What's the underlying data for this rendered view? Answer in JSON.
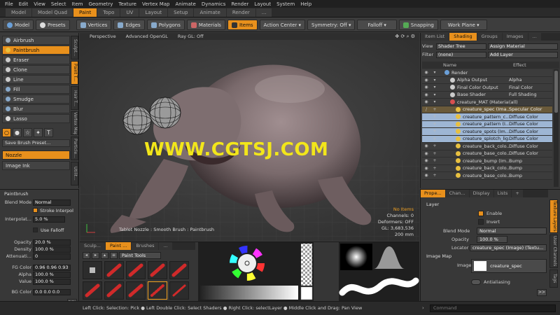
{
  "menu": [
    "File",
    "Edit",
    "View",
    "Select",
    "Item",
    "Geometry",
    "Texture",
    "Vertex Map",
    "Animate",
    "Dynamics",
    "Render",
    "Layout",
    "System",
    "Help"
  ],
  "layout_tabs": [
    "Model",
    "Model Quad",
    "Paint",
    "Topo",
    "UV",
    "Layout",
    "Setup",
    "Animate",
    "Render",
    "..."
  ],
  "active_layout_tab": "Paint",
  "toolbar": {
    "model": "Model",
    "presets": "Presets",
    "vertices": "Vertices",
    "edges": "Edges",
    "polygons": "Polygons",
    "materials": "Materials",
    "items": "Items",
    "action_center": "Action Center",
    "symmetry": "Symmetry: Off",
    "falloff": "Falloff",
    "snapping": "Snapping",
    "work_plane": "Work Plane"
  },
  "tools": [
    "Airbrush",
    "Paintbrush",
    "Eraser",
    "Clone",
    "Line",
    "Fill",
    "Smudge",
    "Blur",
    "Lasso"
  ],
  "active_tool": "Paintbrush",
  "left_vtabs": [
    "Sculpt...",
    "Paint T...",
    "Hair T...",
    "Vertex Map...",
    "Particle...",
    "Utilit..."
  ],
  "brush_icons": [
    "○",
    "●",
    "☆",
    "✦",
    "T"
  ],
  "save_brush_preset": "Save Brush Preset...",
  "nozzle": "Nozzle",
  "image_ink": "Image Ink",
  "paintbrush_props": {
    "title": "Paintbrush",
    "blend_mode_label": "Blend Mode",
    "blend_mode": "Normal",
    "stroke_interp": "Stroke Interpol ...",
    "interpolation_label": "Interpolat...",
    "interpolation": "5.0 %",
    "use_falloff": "Use Falloff",
    "opacity_label": "Opacity",
    "opacity": "20.0 %",
    "density_label": "Density",
    "density": "100.0 %",
    "attenuation_label": "Attenuati...",
    "attenuation": "0",
    "fg_color_label": "FG Color",
    "fg_color": "0.96  0.96  0.93",
    "alpha_label": "Alpha",
    "alpha": "100.0 %",
    "value_label": "Value",
    "value": "100.0 %",
    "bg_color_label": "BG Color",
    "bg_color": "0.0    0.0    0.0"
  },
  "viewport": {
    "perspective": "Perspective",
    "opengl": "Advanced OpenGL",
    "raygl": "Ray GL: Off",
    "no_items": "No Items",
    "channels": "Channels: 0",
    "deformers": "Deformers: OFF",
    "gl": "GL: 3,683,536",
    "size": "200 mm",
    "status": "Tablet Nozzle : Smooth Brush : Paintbrush",
    "watermark": "WWW.CGTSJ.COM"
  },
  "right_tabs": [
    "Item List",
    "Shading",
    "Groups",
    "Images",
    "..."
  ],
  "active_right_tab": "Shading",
  "shader_controls": {
    "view_label": "View",
    "view_value": "Shader Tree",
    "assign_material": "Assign Material",
    "filter_label": "Filter",
    "filter_value": "(none)",
    "add_layer": "Add Layer"
  },
  "shader_tree_header": {
    "name": "Name",
    "effect": "Effect"
  },
  "shader_tree": [
    {
      "name": "Render",
      "effect": "",
      "eye": "◉",
      "dot": "#6a9fd8",
      "indent": 8,
      "state": ""
    },
    {
      "name": "Alpha Output",
      "effect": "Alpha",
      "eye": "◉",
      "dot": "#cccccc",
      "indent": 16,
      "state": ""
    },
    {
      "name": "Final Color Output",
      "effect": "Final Color",
      "eye": "◉",
      "dot": "#cccccc",
      "indent": 16,
      "state": ""
    },
    {
      "name": "Base Shader",
      "effect": "Full Shading",
      "eye": "◉",
      "dot": "#cccccc",
      "indent": 16,
      "state": ""
    },
    {
      "name": "creature_MAT (Material)",
      "effect": "(all)",
      "eye": "◉",
      "dot": "#d85050",
      "indent": 16,
      "state": ""
    },
    {
      "name": "creature_spec (Ima...",
      "effect": "Specular Color",
      "eye": "/",
      "dot": "#e8c040",
      "indent": 24,
      "state": "sel"
    },
    {
      "name": "creature_pattern_c...",
      "effect": "Diffuse Color",
      "eye": "",
      "dot": "#e8c040",
      "indent": 24,
      "state": ""
    },
    {
      "name": "creature_pattern (I...",
      "effect": "Diffuse Color",
      "eye": "",
      "dot": "#e8c040",
      "indent": 24,
      "state": ""
    },
    {
      "name": "creature_spots (Im...",
      "effect": "Diffuse Color",
      "eye": "",
      "dot": "#e8c040",
      "indent": 24,
      "state": ""
    },
    {
      "name": "creature_splotch_lig...",
      "effect": "Diffuse Color",
      "eye": "",
      "dot": "#e8c040",
      "indent": 24,
      "state": ""
    },
    {
      "name": "creature_back_colo...",
      "effect": "Diffuse Color",
      "eye": "◉",
      "dot": "#e8c040",
      "indent": 24,
      "state": ""
    },
    {
      "name": "creature_base_colo...",
      "effect": "Diffuse Color",
      "eye": "◉",
      "dot": "#e8c040",
      "indent": 24,
      "state": ""
    },
    {
      "name": "creature_bump (Im...",
      "effect": "Bump",
      "eye": "◉",
      "dot": "#e8c040",
      "indent": 24,
      "state": ""
    },
    {
      "name": "creature_back_colo...",
      "effect": "Bump",
      "eye": "◉",
      "dot": "#e8c040",
      "indent": 24,
      "state": ""
    },
    {
      "name": "creature_base_colo...",
      "effect": "Bump",
      "eye": "◉",
      "dot": "#e8c040",
      "indent": 24,
      "state": ""
    }
  ],
  "props_tabs": [
    "Prope...",
    "Chan...",
    "Display",
    "Lists",
    "+"
  ],
  "active_props_tab": "Prope...",
  "layer_props": {
    "layer_title": "Layer",
    "enable": "Enable",
    "invert": "Invert",
    "blend_mode_label": "Blend Mode",
    "blend_mode": "Normal",
    "opacity_label": "Opacity",
    "opacity": "100.0 %",
    "locator_label": "Locator",
    "locator": "creature_spec (Image) (Textu...",
    "image_map_title": "Image Map",
    "image_label": "Image",
    "image": "creature_spec",
    "antialiasing": "Antialiasing"
  },
  "props_vtabs": [
    "Texture Layers",
    "User Channels",
    "Tags"
  ],
  "bottom_tabs": [
    "Sculp...",
    "Paint ...",
    "Brushes",
    "..."
  ],
  "active_bottom_tab": "Paint ...",
  "paint_tools_select": "Paint Tools",
  "status_bar": "Left Click: Selection: Pick ● Left Double Click: Select Shaders ● Right Click: selectLayer ● Middle Click and Drag: Pan View",
  "command_placeholder": "Command",
  "colors": {
    "accent": "#e8901c",
    "watermark": "#f2e61a",
    "tree_highlight": "#9eb6d4"
  }
}
